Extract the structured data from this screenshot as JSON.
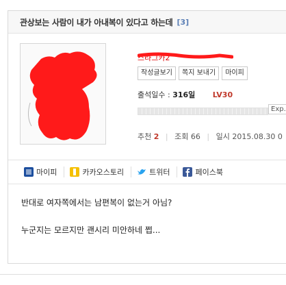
{
  "post": {
    "title": "관상보는 사람이 내가 아내복이 있다고 하는데",
    "comment_count": "[3]"
  },
  "author": {
    "name": "스라그카2"
  },
  "buttons": {
    "posts": "작성글보기",
    "message": "쪽지 보내기",
    "mypi": "마이피"
  },
  "stats": {
    "attendance_label": "출석일수 :",
    "attendance_value": "316일",
    "level": "LV30",
    "exp_label": "Exp.",
    "recommend_label": "추천",
    "recommend_value": "2",
    "views_label": "조회",
    "views_value": "66",
    "date_label": "일시",
    "date_value": "2015.08.30 0"
  },
  "share": {
    "mypi": "마이피",
    "kakao": "카카오스토리",
    "twitter": "트위터",
    "facebook": "페이스북"
  },
  "body": {
    "line1": "반대로 여자쪽에서는 남편복이 없는거 아님?",
    "line2": "누군지는 모르지만 괜시리 미안하네 쩝..."
  },
  "colors": {
    "scribble": "#ff0000",
    "level": "#c0392b",
    "comment_count": "#5b7fb5"
  }
}
